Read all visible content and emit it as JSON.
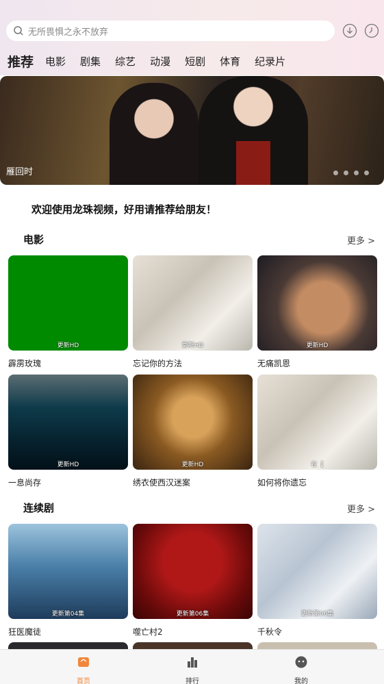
{
  "search": {
    "placeholder": "无所畏惧之永不放弃"
  },
  "tabs": [
    "推荐",
    "电影",
    "剧集",
    "综艺",
    "动漫",
    "短剧",
    "体育",
    "纪录片"
  ],
  "banner": {
    "caption": "雁回时",
    "dots": 4
  },
  "welcome": "欢迎使用龙珠视频，好用请推荐给朋友！",
  "movies": {
    "title": "电影",
    "more": "更多 >",
    "items": [
      {
        "title": "霹雳玫瑰",
        "badge": "更新HD"
      },
      {
        "title": "忘记你的方法",
        "badge": "更新HD"
      },
      {
        "title": "无痛凯恩",
        "badge": "更新HD"
      },
      {
        "title": "一息尚存",
        "badge": "更新HD"
      },
      {
        "title": "绣衣使西汉迷案",
        "badge": "更新HD"
      },
      {
        "title": "如何将你遗忘",
        "badge": "在【"
      }
    ]
  },
  "series": {
    "title": "连续剧",
    "more": "更多 >",
    "items": [
      {
        "title": "狂医魔徒",
        "badge": "更新第04集"
      },
      {
        "title": "噬亡村2",
        "badge": "更新第06集"
      },
      {
        "title": "千秋令",
        "badge": "更新第06集"
      }
    ]
  },
  "nav": [
    {
      "label": "首页",
      "icon": "home-icon"
    },
    {
      "label": "排行",
      "icon": "chart-icon"
    },
    {
      "label": "我的",
      "icon": "profile-icon"
    }
  ],
  "colors": {
    "accent": "#f0873c"
  }
}
